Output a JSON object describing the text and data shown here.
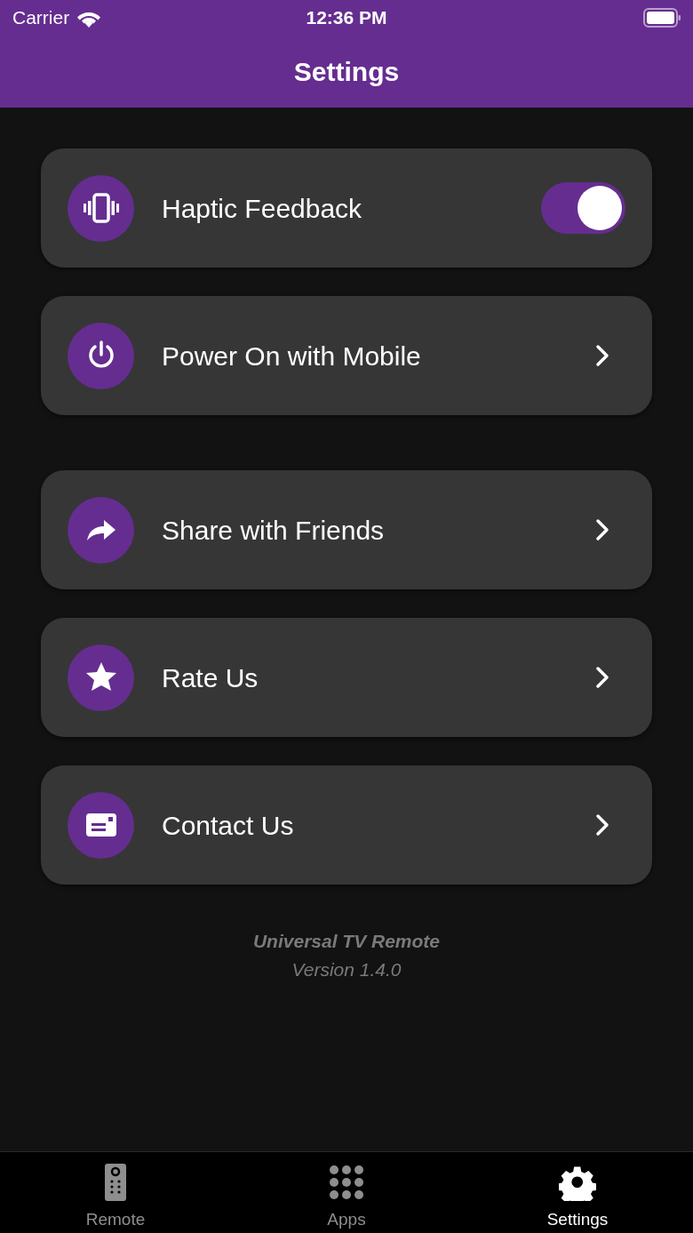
{
  "status_bar": {
    "carrier": "Carrier",
    "time": "12:36 PM"
  },
  "nav": {
    "title": "Settings"
  },
  "sections": [
    {
      "items": [
        {
          "label": "Haptic Feedback",
          "kind": "toggle",
          "on": true
        },
        {
          "label": "Power On with Mobile",
          "kind": "link"
        }
      ]
    },
    {
      "items": [
        {
          "label": "Share with Friends",
          "kind": "link"
        },
        {
          "label": "Rate Us",
          "kind": "link"
        },
        {
          "label": "Contact Us",
          "kind": "link"
        }
      ]
    }
  ],
  "footer": {
    "app_name": "Universal TV Remote",
    "version": "Version 1.4.0"
  },
  "tab_bar": [
    {
      "label": "Remote",
      "selected": false
    },
    {
      "label": "Apps",
      "selected": false
    },
    {
      "label": "Settings",
      "selected": true
    }
  ]
}
